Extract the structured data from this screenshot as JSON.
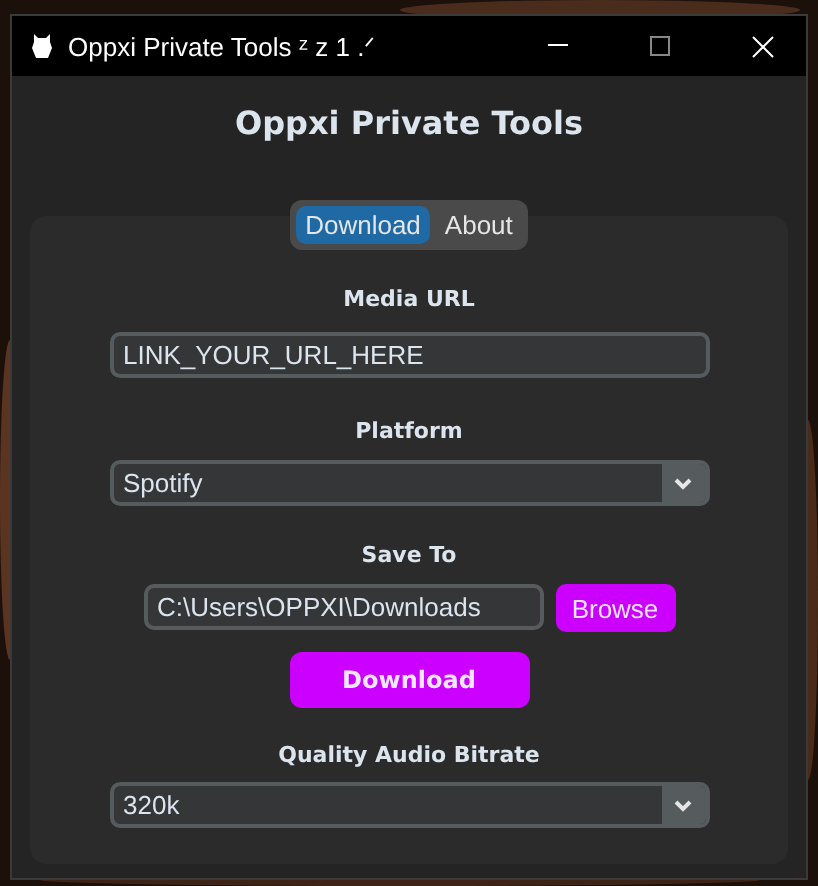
{
  "window": {
    "title": "Oppxi Private Tools ᶻ z 1 .ᐟ"
  },
  "heading": "Oppxi Private Tools",
  "tabs": [
    {
      "label": "Download",
      "selected": true
    },
    {
      "label": "About",
      "selected": false
    }
  ],
  "media_url": {
    "label": "Media URL",
    "value": "LINK_YOUR_URL_HERE"
  },
  "platform": {
    "label": "Platform",
    "value": "Spotify"
  },
  "save_to": {
    "label": "Save To",
    "value": "C:\\Users\\OPPXI\\Downloads",
    "browse": "Browse"
  },
  "download_button": "Download",
  "quality": {
    "label": "Quality Audio Bitrate",
    "value": "320k"
  }
}
